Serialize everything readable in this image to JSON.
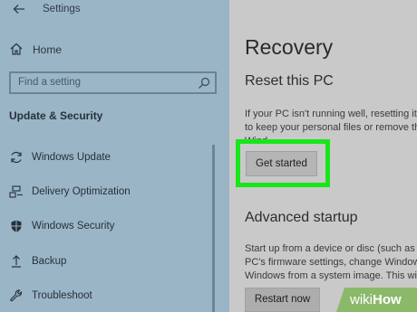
{
  "window": {
    "title": "Settings"
  },
  "sidebar": {
    "home_label": "Home",
    "search_placeholder": "Find a setting",
    "section_title": "Update & Security",
    "items": [
      {
        "label": "Windows Update",
        "icon": "sync-icon"
      },
      {
        "label": "Delivery Optimization",
        "icon": "delivery-optimization-icon"
      },
      {
        "label": "Windows Security",
        "icon": "shield-icon"
      },
      {
        "label": "Backup",
        "icon": "backup-arrow-icon"
      },
      {
        "label": "Troubleshoot",
        "icon": "wrench-icon"
      }
    ]
  },
  "main": {
    "page_title": "Recovery",
    "reset_section": {
      "heading": "Reset this PC",
      "description_lines": [
        "If your PC isn't running well, resetting it",
        "to keep your personal files or remove th",
        "Wind"
      ],
      "button_label": "Get started"
    },
    "advanced_section": {
      "heading": "Advanced startup",
      "description_lines": [
        "Start up from a device or disc (such as",
        "PC's firmware settings, change Window",
        "Windows from a system image. This wi"
      ],
      "button_label": "Restart now"
    }
  },
  "watermark": {
    "part1": "wiki",
    "part2": "How"
  },
  "colors": {
    "sidebar_bg": "#9ab5c6",
    "main_bg": "#c9c9c9",
    "highlight": "#19e61a",
    "watermark_green": "#8bb96a"
  }
}
